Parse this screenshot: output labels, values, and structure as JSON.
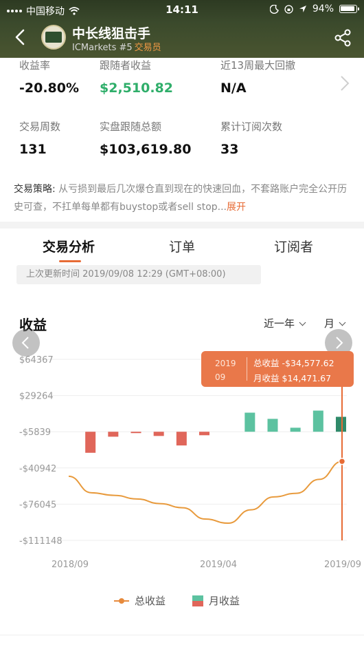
{
  "status_bar": {
    "carrier": "中国移动",
    "time": "14:11",
    "battery": "94%"
  },
  "header": {
    "title": "中长线狙击手",
    "broker": "ICMarkets #5",
    "role": "交易员"
  },
  "stats": [
    {
      "label": "收益率",
      "value": "-20.80%"
    },
    {
      "label": "跟随者收益",
      "value": "$2,510.82"
    },
    {
      "label": "近13周最大回撤",
      "value": "N/A"
    },
    {
      "label": "交易周数",
      "value": "131"
    },
    {
      "label": "实盘跟随总额",
      "value": "$103,619.80"
    },
    {
      "label": "累计订阅次数",
      "value": "33"
    }
  ],
  "strategy": {
    "label": "交易策略:",
    "text": " 从亏损到最后几次爆仓直到现在的快速回血，不套路账户完全公开历史可查，不扛单每单都有buystop或者sell stop...",
    "more": "展开"
  },
  "tabs": [
    "交易分析",
    "订单",
    "订阅者"
  ],
  "updated_text": "上次更新时间 2019/09/08 12:29 (GMT+08:00)",
  "chart_header": {
    "title": "收益",
    "range": "近一年",
    "period": "月"
  },
  "tooltip": {
    "date_year": "2019",
    "date_month": "09",
    "total_label": "总收益",
    "total_value": "-$34,577.62",
    "monthly_label": "月收益",
    "monthly_value": "$14,471.67"
  },
  "legend": {
    "total": "总收益",
    "monthly": "月收益"
  },
  "colors": {
    "accent": "#e76b35",
    "positive": "#5cc2a0",
    "negative": "#e0665a",
    "line": "#e89a3c",
    "brand_green": "#2fae6a"
  },
  "chart_data": {
    "type": "bar",
    "title": "收益",
    "y_ticks": [
      "$64367",
      "$29264",
      "-$5839",
      "-$40942",
      "-$76045",
      "-$111148"
    ],
    "y_tick_values": [
      64367,
      29264,
      -5839,
      -40942,
      -76045,
      -111148
    ],
    "x_ticks": [
      "2018/09",
      "2019/04",
      "2019/09"
    ],
    "ylim": [
      -111148,
      64367
    ],
    "grid": true,
    "legend_placement": "bottom-center",
    "months": [
      "2018/10",
      "2018/11",
      "2018/12",
      "2019/01",
      "2019/02",
      "2019/03",
      "2019/04",
      "2019/05",
      "2019/06",
      "2019/07",
      "2019/08",
      "2019/09"
    ],
    "series": [
      {
        "name": "月收益",
        "kind": "bar",
        "values": [
          -20400,
          -4800,
          -1200,
          -4100,
          -13300,
          -3400,
          0,
          18500,
          12500,
          3900,
          20500,
          14471.67
        ]
      },
      {
        "name": "总收益",
        "kind": "line",
        "points": [
          [
            "2018/09",
            -49000
          ],
          [
            "2018/10",
            -65000
          ],
          [
            "2018/11",
            -67500
          ],
          [
            "2018/12",
            -71000
          ],
          [
            "2019/01",
            -75500
          ],
          [
            "2019/02",
            -79500
          ],
          [
            "2019/03",
            -90500
          ],
          [
            "2019/04",
            -94500
          ],
          [
            "2019/05",
            -81500
          ],
          [
            "2019/06",
            -69000
          ],
          [
            "2019/07",
            -65500
          ],
          [
            "2019/08",
            -52000
          ],
          [
            "2019/09",
            -34577.62
          ]
        ]
      }
    ]
  }
}
